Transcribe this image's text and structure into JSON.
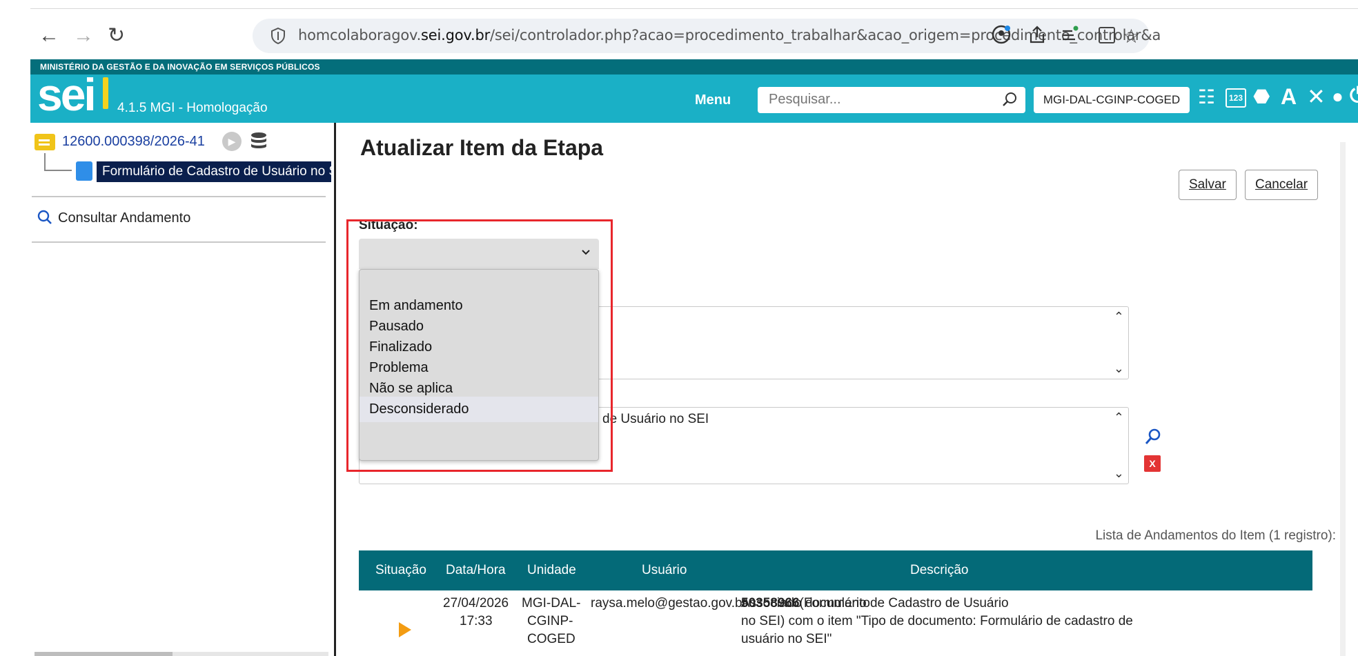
{
  "browser": {
    "back_icon": "arrow-left-icon",
    "forward_icon": "arrow-right-icon",
    "reload_icon": "reload-icon",
    "url_prefix": "homcolaboragov.",
    "url_domain": "sei.gov.br",
    "url_path": "/sei/controlador.php?acao=procedimento_trabalhar&acao_origem=procedimento_controlar&a"
  },
  "header": {
    "ministry": "MINISTÉRIO DA GESTÃO E DA INOVAÇÃO EM SERVIÇOS PÚBLICOS",
    "logo": "sei",
    "version": "4.1.5 MGI - Homologação",
    "menu_label": "Menu",
    "search_placeholder": "Pesquisar...",
    "unit": "MGI-DAL-CGINP-COGED",
    "accent_color": "#1ab0c6",
    "dark_color": "#046e7b"
  },
  "tree": {
    "process_number": "12600.000398/2026-41",
    "document_label": "Formulário de Cadastro de Usuário no SEI",
    "consult_label": "Consultar Andamento"
  },
  "main": {
    "title": "Atualizar Item da Etapa",
    "save_label": "Salvar",
    "cancel_label": "Cancelar",
    "situation_label": "Situação:",
    "situation_value": "",
    "options": [
      "Em andamento",
      "Pausado",
      "Finalizado",
      "Problema",
      "Não se aplica",
      "Desconsiderado"
    ],
    "linked_text": "de Usuário no SEI",
    "list_caption": "Lista de Andamentos do Item (1 registro):"
  },
  "table": {
    "headers": [
      "Situação",
      "Data/Hora",
      "Unidade",
      "Usuário",
      "Descrição"
    ],
    "row": {
      "date": "27/04/2026",
      "time": "17:33",
      "unit_1": "MGI-DAL-",
      "unit_2": "CGINP-",
      "unit_3": "COGED",
      "user": "raysa.melo@gestao.gov.br",
      "desc_1a": "Associado documento ",
      "desc_1b": "50358966",
      "desc_1c": " (Formulário de Cadastro de Usuário",
      "desc_2": "no SEI) com o item \"Tipo de documento: Formulário de cadastro de",
      "desc_3": "usuário no SEI\""
    }
  }
}
